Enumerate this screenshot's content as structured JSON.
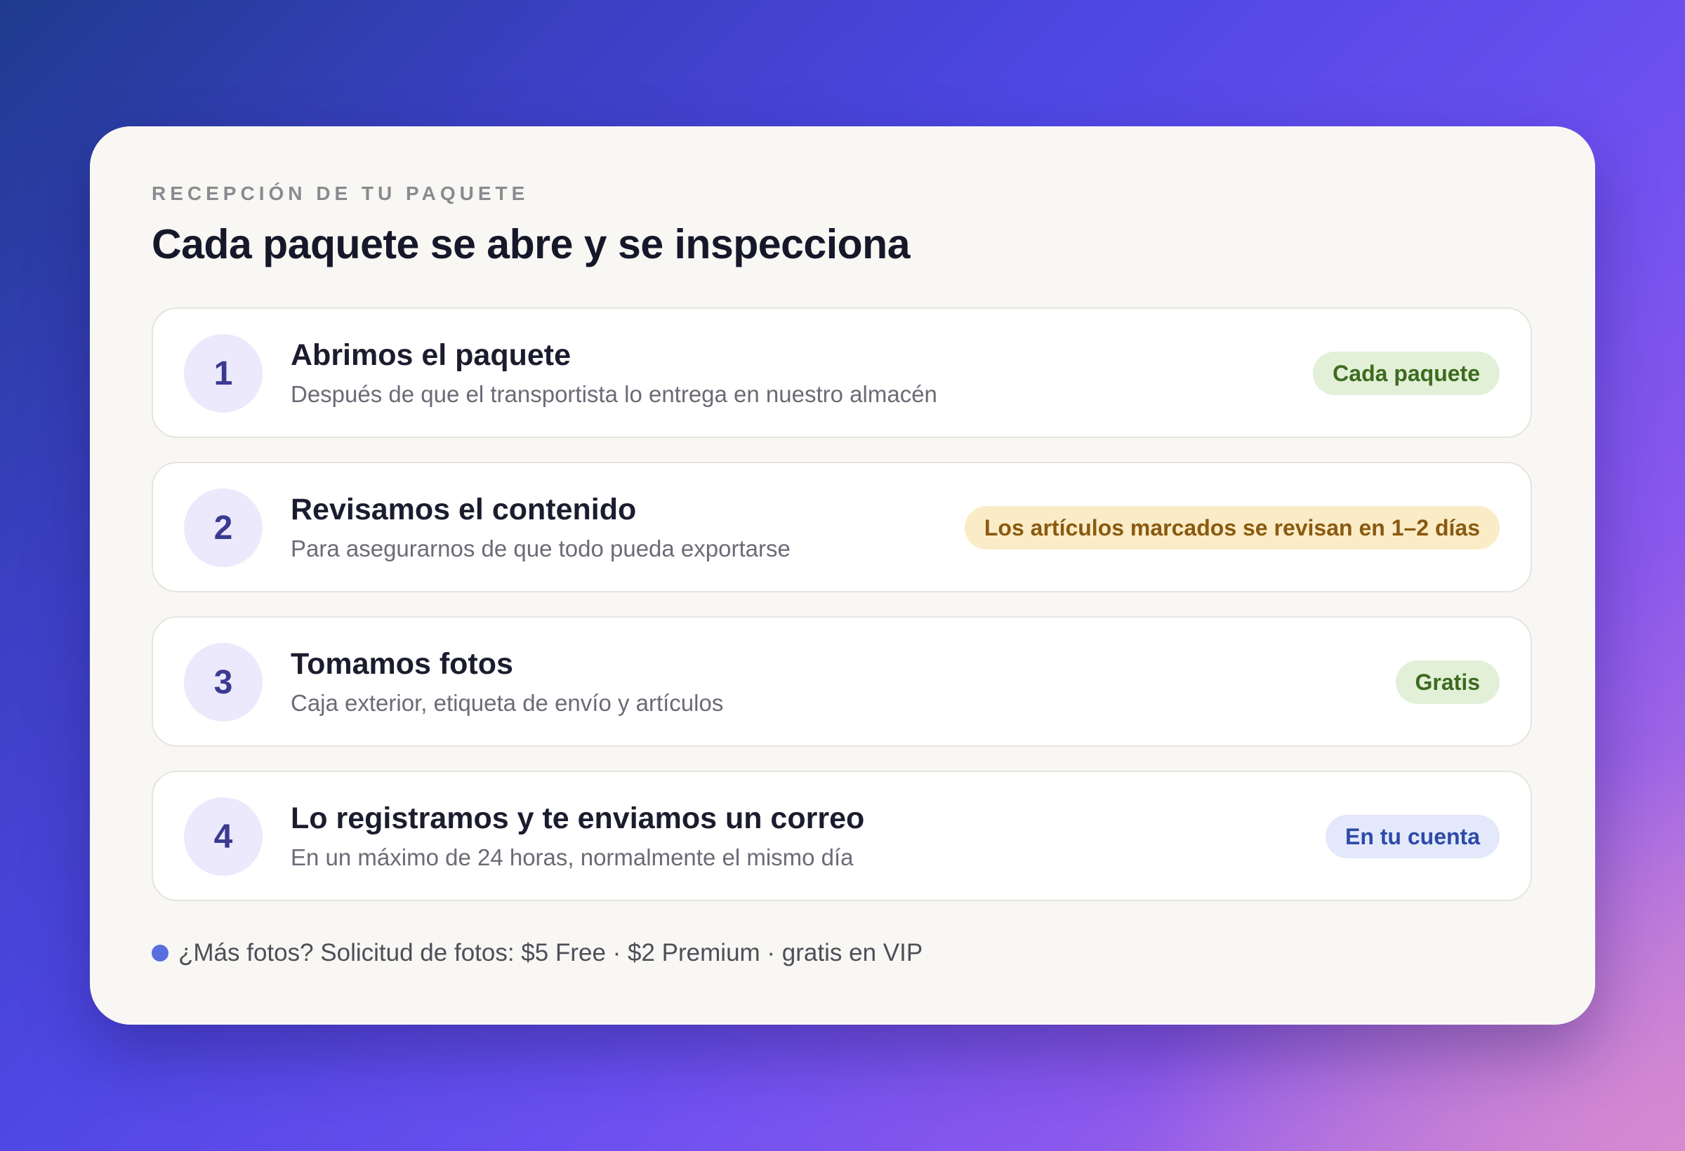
{
  "card": {
    "eyebrow": "RECEPCIÓN DE TU PAQUETE",
    "title": "Cada paquete se abre y se inspecciona"
  },
  "steps": [
    {
      "number": "1",
      "title": "Abrimos el paquete",
      "description": "Después de que el transportista lo entrega en nuestro almacén",
      "badge": "Cada paquete",
      "badge_tone": "green"
    },
    {
      "number": "2",
      "title": "Revisamos el contenido",
      "description": "Para asegurarnos de que todo pueda exportarse",
      "badge": "Los artículos marcados se revisan en 1–2 días",
      "badge_tone": "amber"
    },
    {
      "number": "3",
      "title": "Tomamos fotos",
      "description": "Caja exterior, etiqueta de envío y artículos",
      "badge": "Gratis",
      "badge_tone": "green"
    },
    {
      "number": "4",
      "title": "Lo registramos y te enviamos un correo",
      "description": "En un máximo de 24 horas, normalmente el mismo día",
      "badge": "En tu cuenta",
      "badge_tone": "blue"
    }
  ],
  "footnote": {
    "text": "¿Más fotos? Solicitud de fotos: $5 Free · $2 Premium · gratis en VIP",
    "dot_color": "#5b6ee0"
  },
  "colors": {
    "badge_green_bg": "#e3f0d8",
    "badge_green_text": "#3d6b1f",
    "badge_amber_bg": "#fbecc8",
    "badge_amber_text": "#8a5a10",
    "badge_blue_bg": "#e3e9fa",
    "badge_blue_text": "#2e4aa8",
    "step_number_bg": "#ebe9fb",
    "step_number_text": "#3b3a91"
  }
}
